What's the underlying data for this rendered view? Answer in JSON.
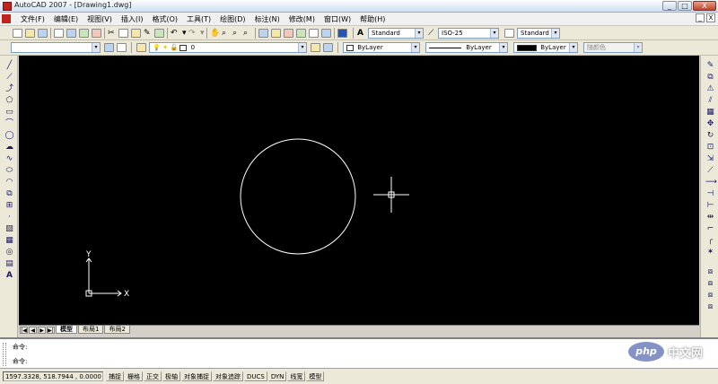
{
  "window": {
    "title": "AutoCAD 2007 - [Drawing1.dwg]",
    "controls": [
      "_",
      "□",
      "X"
    ]
  },
  "menu": {
    "items": [
      "文件(F)",
      "编辑(E)",
      "视图(V)",
      "插入(I)",
      "格式(O)",
      "工具(T)",
      "绘图(D)",
      "标注(N)",
      "修改(M)",
      "窗口(W)",
      "帮助(H)"
    ],
    "doc_controls": [
      "_",
      "X"
    ]
  },
  "styles_toolbar": {
    "text_style": "Standard",
    "dim_style": "ISO-25",
    "table_style": "Standard"
  },
  "layers_toolbar": {
    "current_layer": "0"
  },
  "properties_toolbar": {
    "color": "ByLayer",
    "linetype": "ByLayer",
    "lineweight": "ByLayer",
    "plot_style": "随颜色"
  },
  "drawing": {
    "background_color": "#000000",
    "ucs_y_label": "Y",
    "ucs_x_label": "X"
  },
  "layout_tabs": {
    "nav_buttons": [
      "|◀",
      "◀",
      "▶",
      "▶|"
    ],
    "tabs": [
      "模型",
      "布局1",
      "布局2"
    ]
  },
  "command": {
    "history_line": "命令:",
    "prompt_line": "命令:"
  },
  "status": {
    "coordinates": "1597.3328, 518.7944 , 0.0000",
    "toggles": [
      "捕捉",
      "栅格",
      "正交",
      "极轴",
      "对象捕捉",
      "对象追踪",
      "DUCS",
      "DYN",
      "线宽",
      "模型"
    ]
  },
  "watermark": {
    "logo": "php",
    "text": "中文网"
  }
}
